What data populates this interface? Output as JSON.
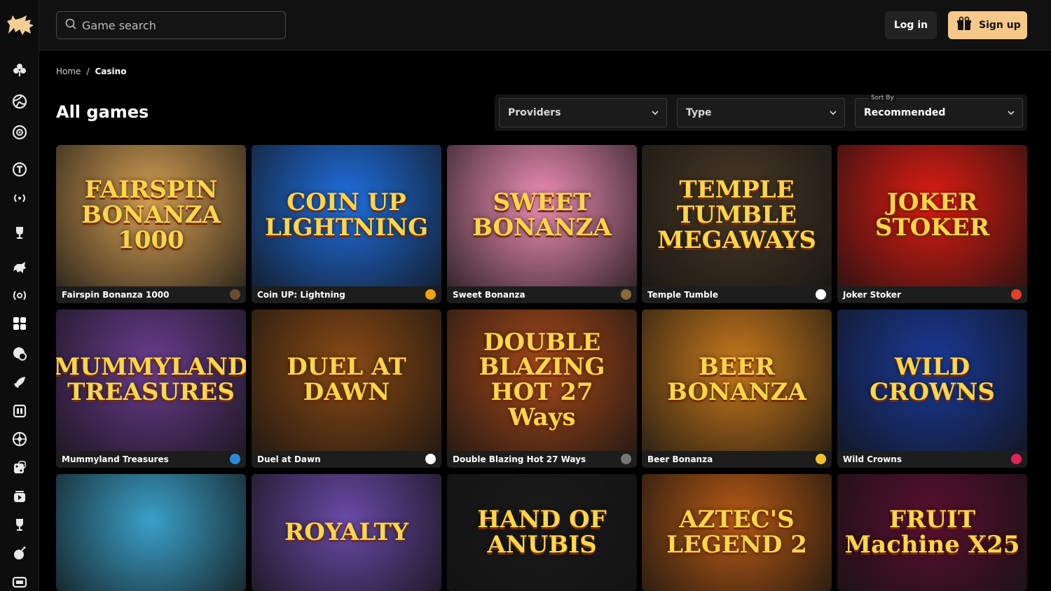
{
  "header": {
    "search_placeholder": "Game search",
    "login_label": "Log in",
    "signup_label": "Sign up"
  },
  "breadcrumb": {
    "home": "Home",
    "separator": "/",
    "current": "Casino"
  },
  "page_title": "All games",
  "filters": {
    "providers": "Providers",
    "type": "Type",
    "sort_label": "Sort By",
    "sort_value": "Recommended"
  },
  "sidebar": {
    "icons": [
      "clover-icon",
      "volleyball-icon",
      "roulette-icon",
      "t-coin-icon",
      "live-broadcast-icon",
      "trophy-icon",
      "lion-icon",
      "live-signal-icon",
      "grid-icon",
      "poker-chip-icon",
      "rocket-icon",
      "slot-machine-icon",
      "wheel-icon",
      "dice-icon",
      "card-stack-icon",
      "cup-icon",
      "bomb-icon",
      "tv-icon"
    ]
  },
  "games": [
    {
      "name": "Fairspin Bonanza 1000",
      "art": "FAIRSPIN BONANZA 1000",
      "color": "#d9a255",
      "badge": "#6d4c2d"
    },
    {
      "name": "Coin UP: Lightning",
      "art": "COIN UP LIGHTNING",
      "color": "#1f6fe0",
      "badge": "#f2a20d"
    },
    {
      "name": "Sweet Bonanza",
      "art": "SWEET BONANZA",
      "color": "#f08fb6",
      "badge": "#8a6a3a"
    },
    {
      "name": "Temple Tumble",
      "art": "TEMPLE TUMBLE MEGAWAYS",
      "color": "#4a3a26",
      "badge": "#ffffff"
    },
    {
      "name": "Joker Stoker",
      "art": "JOKER STOKER",
      "color": "#e01c12",
      "badge": "#e0402a"
    },
    {
      "name": "Mummyland Treasures",
      "art": "MUMMYLAND TREASURES",
      "color": "#6a3d8f",
      "badge": "#2a8ad8"
    },
    {
      "name": "Duel at Dawn",
      "art": "DUEL AT DAWN",
      "color": "#8a4a14",
      "badge": "#ffffff"
    },
    {
      "name": "Double Blazing Hot 27 Ways",
      "art": "DOUBLE BLAZING HOT 27 Ways",
      "color": "#a84a1a",
      "badge": "#777777"
    },
    {
      "name": "Beer Bonanza",
      "art": "BEER BONANZA",
      "color": "#c9791c",
      "badge": "#f2c230"
    },
    {
      "name": "Wild Crowns",
      "art": "WILD CROWNS",
      "color": "#1a3a9a",
      "badge": "#e0235b"
    },
    {
      "name": "",
      "art": "",
      "color": "#3aa0c8",
      "badge": ""
    },
    {
      "name": "",
      "art": "ROYALTY",
      "color": "#6a4aa8",
      "badge": ""
    },
    {
      "name": "",
      "art": "HAND OF ANUBIS",
      "color": "#1a1a1a",
      "badge": ""
    },
    {
      "name": "",
      "art": "AZTEC'S LEGEND 2",
      "color": "#b85a14",
      "badge": ""
    },
    {
      "name": "",
      "art": "FRUIT Machine X25",
      "color": "#5a1030",
      "badge": ""
    }
  ]
}
